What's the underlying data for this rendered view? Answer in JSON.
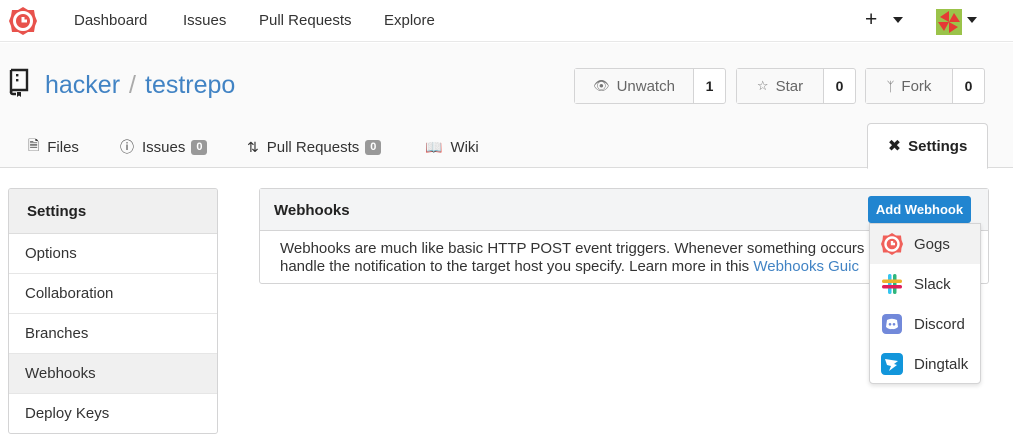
{
  "topnav": {
    "links": [
      "Dashboard",
      "Issues",
      "Pull Requests",
      "Explore"
    ],
    "plus": "+"
  },
  "repo": {
    "owner": "hacker",
    "separator": "/",
    "name": "testrepo",
    "watch": {
      "label": "Unwatch",
      "count": "1"
    },
    "star": {
      "label": "Star",
      "count": "0"
    },
    "fork": {
      "label": "Fork",
      "count": "0"
    }
  },
  "tabs": {
    "files": "Files",
    "issues": "Issues",
    "issues_count": "0",
    "pulls": "Pull Requests",
    "pulls_count": "0",
    "wiki": "Wiki",
    "settings": "Settings"
  },
  "menu": {
    "header": "Settings",
    "items": [
      "Options",
      "Collaboration",
      "Branches",
      "Webhooks",
      "Deploy Keys"
    ],
    "active_index": 3
  },
  "webhooks": {
    "title": "Webhooks",
    "desc_line1": "Webhooks are much like basic HTTP POST event triggers. Whenever something occurs i",
    "desc_line2": "handle the notification to the target host you specify. Learn more in this ",
    "guide_link": "Webhooks Guic",
    "add_button": "Add Webhook",
    "dropdown": [
      "Gogs",
      "Slack",
      "Discord",
      "Dingtalk"
    ]
  },
  "colors": {
    "link": "#4183c4",
    "primary": "#2185d0",
    "gogs": "#f0605a",
    "discord": "#7289da",
    "dingtalk": "#1296db"
  }
}
